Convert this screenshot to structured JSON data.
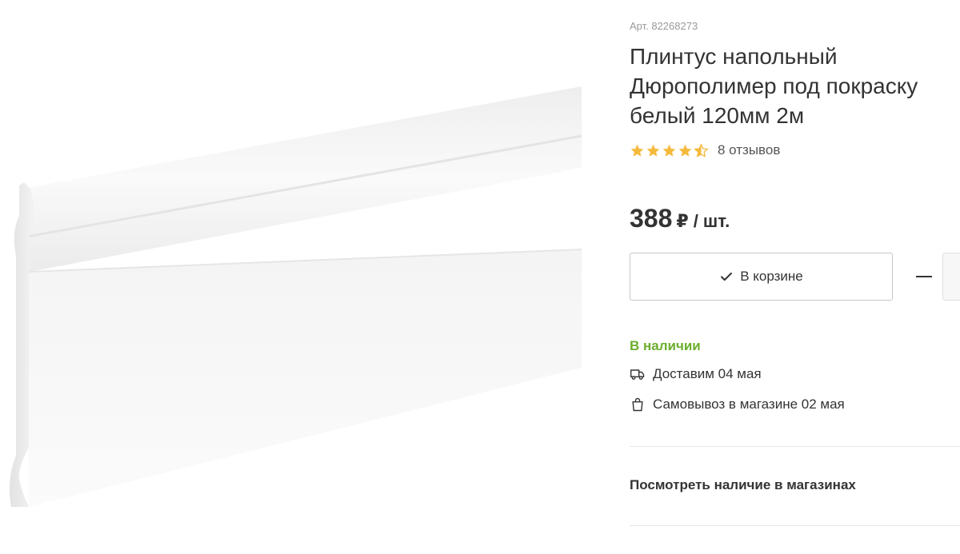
{
  "product": {
    "article": "Арт. 82268273",
    "title": "Плинтус напольный Дюрополимер под покраску белый 120мм 2м",
    "rating": {
      "value": 4.5,
      "max": 5,
      "reviews_label": "8 отзывов",
      "star_color": "#f5b93d"
    },
    "price": {
      "value": "388",
      "currency": "₽",
      "unit": "/ шт."
    },
    "cart": {
      "button_label": "В корзине",
      "check_icon": "check-icon"
    },
    "quantity": {
      "minus_icon": "minus-icon"
    },
    "availability": {
      "stock_label": "В наличии",
      "stock_color": "#6cae2d",
      "delivery_label": "Доставим 04 мая",
      "delivery_icon": "truck-icon",
      "pickup_label": "Самовывоз в магазине 02 мая",
      "pickup_icon": "bag-icon"
    },
    "stores_link": "Посмотреть наличие в магазинах"
  }
}
